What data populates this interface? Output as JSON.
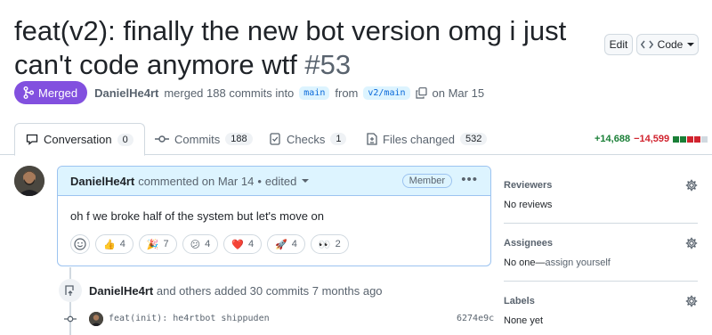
{
  "pr": {
    "title": "feat(v2): finally the new bot version omg i just can't code anymore wtf",
    "number": "#53",
    "edit_label": "Edit",
    "code_label": "Code",
    "status_label": "Merged",
    "author": "DanielHe4rt",
    "merged_text": "merged 188 commits into",
    "base_branch": "main",
    "from_text": "from",
    "head_branch": "v2/main",
    "date_text": "on Mar 15"
  },
  "tabs": [
    {
      "label": "Conversation",
      "count": "0"
    },
    {
      "label": "Commits",
      "count": "188"
    },
    {
      "label": "Checks",
      "count": "1"
    },
    {
      "label": "Files changed",
      "count": "532"
    }
  ],
  "diffstat": {
    "additions": "+14,688",
    "deletions": "−14,599"
  },
  "comment": {
    "author": "DanielHe4rt",
    "action": "commented on Mar 14",
    "separator": "•",
    "edited": "edited",
    "role": "Member",
    "body": "oh f we broke half of the system but let's move on",
    "reactions": [
      {
        "emoji": "👍",
        "count": "4"
      },
      {
        "emoji": "🎉",
        "count": "7"
      },
      {
        "emoji": "😕",
        "count": "4"
      },
      {
        "emoji": "❤️",
        "count": "4"
      },
      {
        "emoji": "🚀",
        "count": "4"
      },
      {
        "emoji": "👀",
        "count": "2"
      }
    ]
  },
  "timeline": {
    "user": "DanielHe4rt",
    "text": "and others added 30 commits 7 months ago",
    "commit_message": "feat(init): he4rtbot shippuden",
    "commit_sha": "6274e9c"
  },
  "sidebar": {
    "reviewers_title": "Reviewers",
    "reviewers_value": "No reviews",
    "assignees_title": "Assignees",
    "assignees_value": "No one—",
    "assignees_link": "assign yourself",
    "labels_title": "Labels",
    "labels_value": "None yet"
  },
  "colors": {
    "merged": "#8250df",
    "addition": "#1a7f37",
    "deletion": "#d1242f",
    "link": "#0969da"
  }
}
